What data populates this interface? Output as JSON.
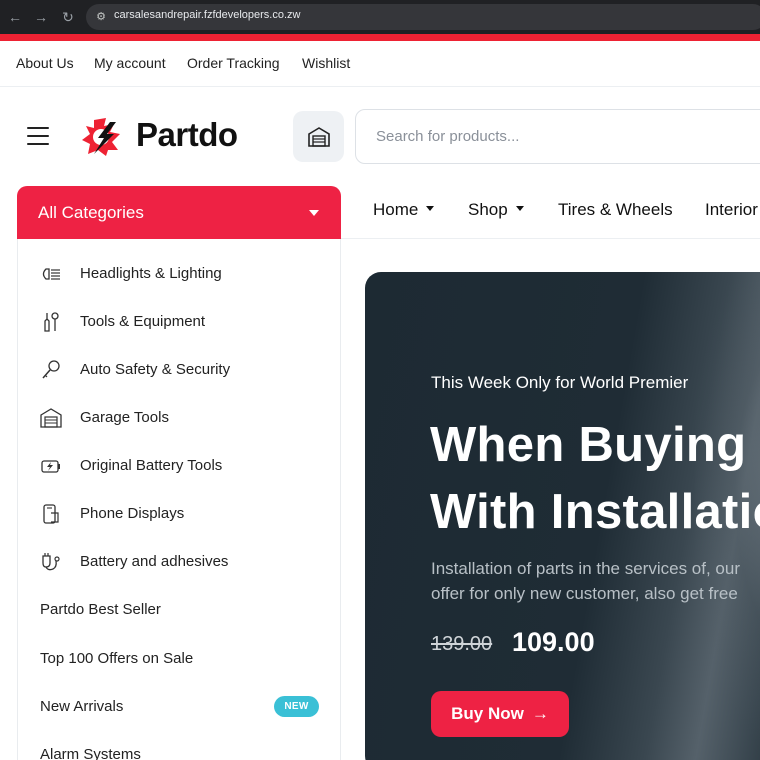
{
  "browser": {
    "url": "carsalesandrepair.fzfdevelopers.co.zw"
  },
  "top_links": [
    "About Us",
    "My account",
    "Order Tracking",
    "Wishlist"
  ],
  "header": {
    "logo_text": "Partdo",
    "search_placeholder": "Search for products..."
  },
  "categories": {
    "title": "All Categories",
    "items": [
      {
        "label": "Headlights & Lighting",
        "icon": "headlight-icon"
      },
      {
        "label": "Tools & Equipment",
        "icon": "tools-icon"
      },
      {
        "label": "Auto Safety & Security",
        "icon": "key-icon"
      },
      {
        "label": "Garage Tools",
        "icon": "garage-icon"
      },
      {
        "label": "Original Battery Tools",
        "icon": "battery-icon"
      },
      {
        "label": "Phone Displays",
        "icon": "phone-icon"
      },
      {
        "label": "Battery and adhesives",
        "icon": "plug-icon"
      },
      {
        "label": "Partdo Best Seller"
      },
      {
        "label": "Top 100 Offers on Sale"
      },
      {
        "label": "New Arrivals",
        "badge": "NEW"
      },
      {
        "label": "Alarm Systems"
      }
    ]
  },
  "main_nav": [
    {
      "label": "Home",
      "dropdown": true
    },
    {
      "label": "Shop",
      "dropdown": true
    },
    {
      "label": "Tires & Wheels",
      "dropdown": false
    },
    {
      "label": "Interior",
      "dropdown": false
    }
  ],
  "hero": {
    "kicker": "This Week Only for World Premier",
    "headline_1": "When Buying Parts",
    "headline_2": "With Installation",
    "desc_1": "Installation of parts in the services of, our",
    "desc_2": "offer for only new customer, also get free",
    "old_price": "139.00",
    "new_price": "109.00",
    "button_label": "Buy Now",
    "button_arrow": "→"
  },
  "colors": {
    "accent": "#ee2244",
    "badge": "#3ac0d6",
    "hero_bg": "#1d2a33"
  }
}
